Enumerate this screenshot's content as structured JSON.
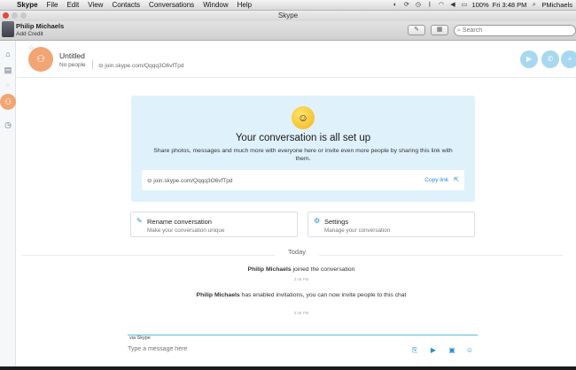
{
  "menubar": {
    "app": "Skype",
    "items": [
      "File",
      "Edit",
      "View",
      "Contacts",
      "Conversations",
      "Window",
      "Help"
    ],
    "battery": "100%",
    "clock": "Fri 3:48 PM",
    "user": "PMichaels"
  },
  "window": {
    "title": "Skype"
  },
  "profile": {
    "name": "Philip Michaels",
    "sub": "Add Credit"
  },
  "search": {
    "placeholder": "Search"
  },
  "conversation": {
    "title": "Untitled",
    "people": "No people",
    "link": "join.skype.com/Qqqq3O6vfTpd"
  },
  "banner": {
    "title": "Your conversation is all set up",
    "text": "Share photos, messages and much more with everyone here or invite even more people by sharing this link with them.",
    "link": "join.skype.com/Qqqq3O6vfTpd",
    "copy_label": "Copy link"
  },
  "cards": {
    "rename": {
      "title": "Rename conversation",
      "subtitle": "Make your conversation unique"
    },
    "settings": {
      "title": "Settings",
      "subtitle": "Manage your conversation"
    }
  },
  "timeline": {
    "day": "Today",
    "events": [
      {
        "actor": "Philip Michaels",
        "text": "joined the conversation",
        "time": "3:48 PM"
      },
      {
        "actor": "Philip Michaels",
        "text": "has enabled invitations, you can now invite people to this chat",
        "time": "3:48 PM"
      }
    ]
  },
  "composer": {
    "via": "via Skype",
    "placeholder": "Type a message here"
  },
  "colors": {
    "accent": "#2a8fd0",
    "group_avatar": "#f1a574",
    "banner_bg": "#dff1fb"
  },
  "icons": [
    "home-icon",
    "contacts-icon",
    "recent-icon",
    "group-icon",
    "history-icon",
    "video-call-icon",
    "audio-call-icon",
    "add-people-icon",
    "link-icon",
    "share-icon",
    "pencil-icon",
    "gear-icon",
    "emoticon-icon",
    "send-file-icon",
    "send-video-icon",
    "send-contact-icon"
  ]
}
